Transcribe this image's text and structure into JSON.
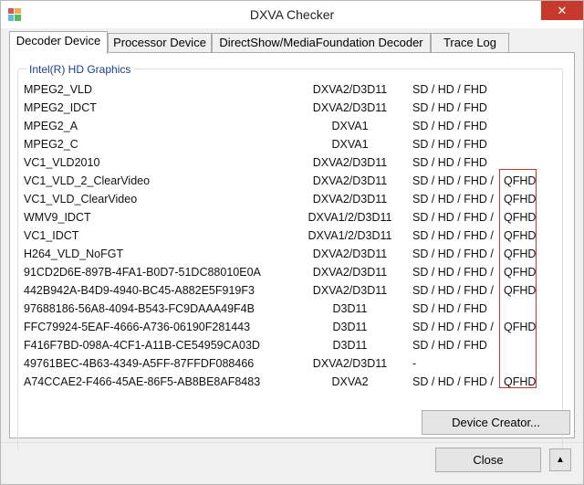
{
  "window": {
    "title": "DXVA Checker",
    "close_glyph": "✕"
  },
  "tabs": [
    {
      "label": "Decoder Device",
      "active": true
    },
    {
      "label": "Processor Device",
      "active": false
    },
    {
      "label": "DirectShow/MediaFoundation Decoder",
      "active": false
    },
    {
      "label": "Trace Log",
      "active": false
    }
  ],
  "group": {
    "title": "Intel(R) HD Graphics"
  },
  "decoders": [
    {
      "name": "MPEG2_VLD",
      "api": "DXVA2/D3D11",
      "res": "SD / HD / FHD",
      "qfhd": ""
    },
    {
      "name": "MPEG2_IDCT",
      "api": "DXVA2/D3D11",
      "res": "SD / HD / FHD",
      "qfhd": ""
    },
    {
      "name": "MPEG2_A",
      "api": "DXVA1",
      "res": "SD / HD / FHD",
      "qfhd": ""
    },
    {
      "name": "MPEG2_C",
      "api": "DXVA1",
      "res": "SD / HD / FHD",
      "qfhd": ""
    },
    {
      "name": "VC1_VLD2010",
      "api": "DXVA2/D3D11",
      "res": "SD / HD / FHD",
      "qfhd": ""
    },
    {
      "name": "VC1_VLD_2_ClearVideo",
      "api": "DXVA2/D3D11",
      "res": "SD / HD / FHD /",
      "qfhd": "QFHD"
    },
    {
      "name": "VC1_VLD_ClearVideo",
      "api": "DXVA2/D3D11",
      "res": "SD / HD / FHD /",
      "qfhd": "QFHD"
    },
    {
      "name": "WMV9_IDCT",
      "api": "DXVA1/2/D3D11",
      "res": "SD / HD / FHD /",
      "qfhd": "QFHD"
    },
    {
      "name": "VC1_IDCT",
      "api": "DXVA1/2/D3D11",
      "res": "SD / HD / FHD /",
      "qfhd": "QFHD"
    },
    {
      "name": "H264_VLD_NoFGT",
      "api": "DXVA2/D3D11",
      "res": "SD / HD / FHD /",
      "qfhd": "QFHD"
    },
    {
      "name": "91CD2D6E-897B-4FA1-B0D7-51DC88010E0A",
      "api": "DXVA2/D3D11",
      "res": "SD / HD / FHD /",
      "qfhd": "QFHD"
    },
    {
      "name": "442B942A-B4D9-4940-BC45-A882E5F919F3",
      "api": "DXVA2/D3D11",
      "res": "SD / HD / FHD /",
      "qfhd": "QFHD"
    },
    {
      "name": "97688186-56A8-4094-B543-FC9DAAA49F4B",
      "api": "D3D11",
      "res": "SD / HD / FHD",
      "qfhd": ""
    },
    {
      "name": "FFC79924-5EAF-4666-A736-06190F281443",
      "api": "D3D11",
      "res": "SD / HD / FHD /",
      "qfhd": "QFHD"
    },
    {
      "name": "F416F7BD-098A-4CF1-A11B-CE54959CA03D",
      "api": "D3D11",
      "res": "SD / HD / FHD",
      "qfhd": ""
    },
    {
      "name": "49761BEC-4B63-4349-A5FF-87FFDF088466",
      "api": "DXVA2/D3D11",
      "res": "-",
      "qfhd": ""
    },
    {
      "name": "A74CCAE2-F466-45AE-86F5-AB8BE8AF8483",
      "api": "DXVA2",
      "res": "SD / HD / FHD /",
      "qfhd": "QFHD"
    }
  ],
  "buttons": {
    "device_creator": "Device Creator...",
    "close": "Close",
    "up_glyph": "▲"
  },
  "colors": {
    "accent_red": "#c0392b",
    "group_title": "#1a3e8c"
  }
}
